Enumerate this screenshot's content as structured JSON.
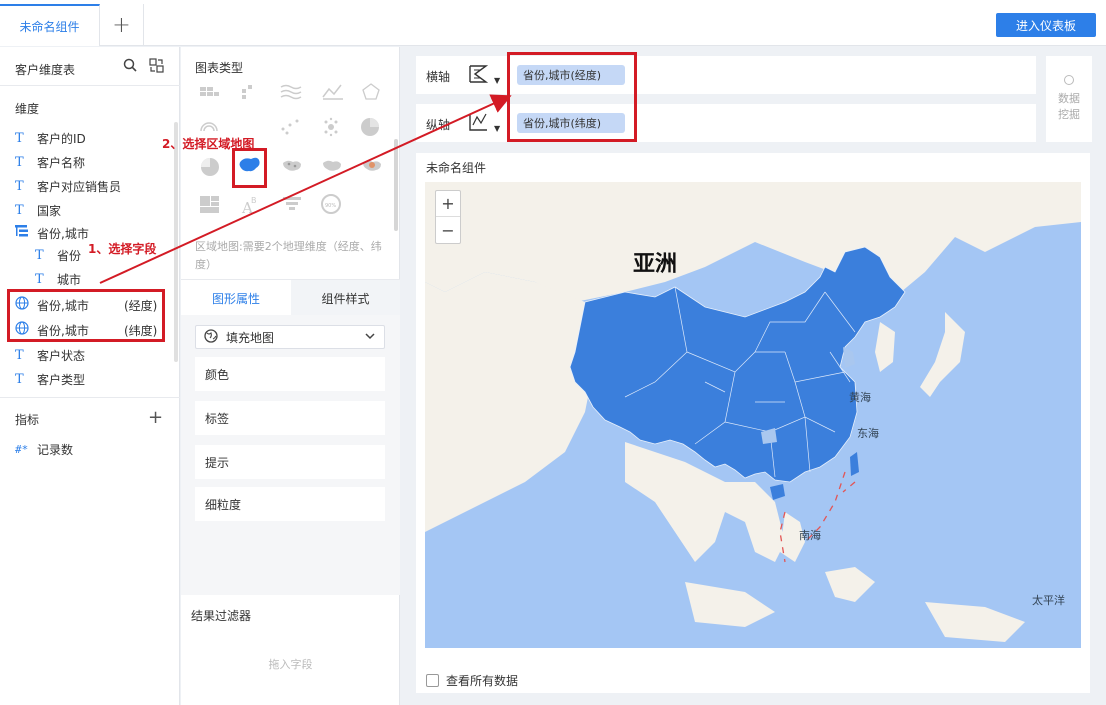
{
  "topbar": {
    "active_tab": "未命名组件",
    "add_tab": "+",
    "enter_dashboard": "进入仪表板"
  },
  "left": {
    "table_name": "客户维度表",
    "dimension_title": "维度",
    "dimensions": [
      {
        "type": "text",
        "label": "客户的ID"
      },
      {
        "type": "text",
        "label": "客户名称"
      },
      {
        "type": "text",
        "label": "客户对应销售员"
      },
      {
        "type": "text",
        "label": "国家"
      },
      {
        "type": "hierarchy",
        "label": "省份,城市"
      },
      {
        "type": "text-child",
        "label": "省份"
      },
      {
        "type": "text-child",
        "label": "城市"
      },
      {
        "type": "geo",
        "label": "省份,城市",
        "suffix": "(经度)"
      },
      {
        "type": "geo",
        "label": "省份,城市",
        "suffix": "(纬度)"
      },
      {
        "type": "text",
        "label": "客户状态"
      },
      {
        "type": "text",
        "label": "客户类型"
      }
    ],
    "metric_title": "指标",
    "metrics": [
      {
        "label": "记录数"
      }
    ]
  },
  "middle": {
    "chart_type_title": "图表类型",
    "map_desc": "区域地图:需要2个地理维度（经度、纬度）",
    "tab_graph": "图形属性",
    "tab_style": "组件样式",
    "map_select": "填充地图",
    "props": [
      "颜色",
      "标签",
      "提示",
      "细粒度"
    ],
    "filter_title": "结果过滤器",
    "filter_placeholder": "拖入字段"
  },
  "axes": {
    "x_label": "横轴",
    "x_field": "省份,城市(经度)",
    "y_label": "纵轴",
    "y_field": "省份,城市(纬度)"
  },
  "mining": {
    "line1": "数据",
    "line2": "挖掘"
  },
  "widget": {
    "title": "未命名组件",
    "zoom_in": "+",
    "zoom_out": "−",
    "continent": "亚洲",
    "seas": {
      "yellow": "黄海",
      "east": "东海",
      "south": "南海",
      "pacific": "太平洋"
    },
    "show_all": "查看所有数据"
  },
  "annotations": {
    "step1": "1、选择字段",
    "step2": "2、选择区域地图"
  },
  "colors": {
    "accent": "#2d7fe8",
    "china_fill": "#3b7fdc",
    "ocean": "#a4c6f4",
    "land": "#f4f1ea",
    "annotation": "#d31b25"
  }
}
